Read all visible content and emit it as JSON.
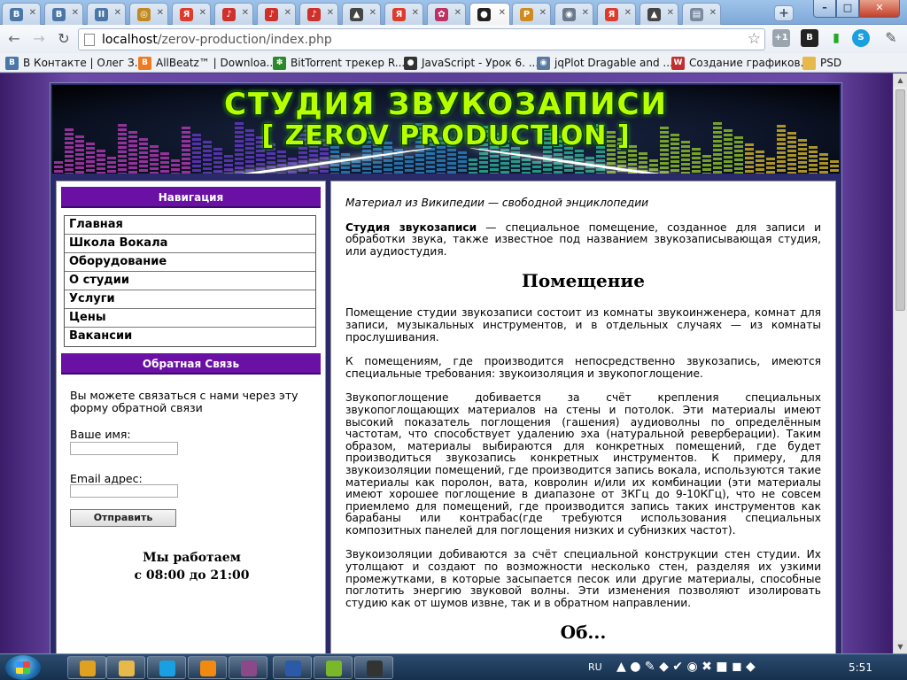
{
  "browser": {
    "tabs": [
      {
        "icon": "vk-icon",
        "glyph": "В",
        "color": "#4a76a8"
      },
      {
        "icon": "vk-icon",
        "glyph": "В",
        "color": "#4a76a8"
      },
      {
        "icon": "pause-icon",
        "glyph": "II",
        "color": "#4a76a8"
      },
      {
        "icon": "ring-icon",
        "glyph": "◎",
        "color": "#c08a20"
      },
      {
        "icon": "yandex-icon",
        "glyph": "Я",
        "color": "#e03a2a"
      },
      {
        "icon": "guitar-icon",
        "glyph": "♪",
        "color": "#d0302a"
      },
      {
        "icon": "guitar-icon",
        "glyph": "♪",
        "color": "#d0302a"
      },
      {
        "icon": "guitar-icon",
        "glyph": "♪",
        "color": "#d0302a"
      },
      {
        "icon": "mortarboard-icon",
        "glyph": "▲",
        "color": "#444444"
      },
      {
        "icon": "yandex-icon",
        "glyph": "Я",
        "color": "#e03a2a"
      },
      {
        "icon": "flower-icon",
        "glyph": "✿",
        "color": "#c03060"
      },
      {
        "icon": "spy-icon",
        "glyph": "●",
        "color": "#222222"
      },
      {
        "icon": "pma-icon",
        "glyph": "P",
        "color": "#d08a20"
      },
      {
        "icon": "globe-icon",
        "glyph": "◉",
        "color": "#6a7a8a"
      },
      {
        "icon": "yandex-icon",
        "glyph": "Я",
        "color": "#e03a2a"
      },
      {
        "icon": "mortarboard-icon",
        "glyph": "▲",
        "color": "#444444"
      },
      {
        "icon": "document-icon",
        "glyph": "▤",
        "color": "#7a8aa0"
      }
    ],
    "url_host": "localhost",
    "url_path": "/zerov-production/index.php",
    "bookmarks": [
      {
        "label": "В Контакте | Олег З...",
        "icon": "vk-icon",
        "glyph": "В",
        "color": "#4a76a8"
      },
      {
        "label": "AllBeatz™ | Downloa...",
        "icon": "blogger-icon",
        "glyph": "B",
        "color": "#f07a20"
      },
      {
        "label": "BitTorrent трекер R...",
        "icon": "rutracker-icon",
        "glyph": "✽",
        "color": "#2a8a2a"
      },
      {
        "label": "JavaScript - Урок 6. ...",
        "icon": "ball-icon",
        "glyph": "●",
        "color": "#333333"
      },
      {
        "label": "jqPlot Dragable and ...",
        "icon": "globe-icon",
        "glyph": "◉",
        "color": "#5a7aa0"
      },
      {
        "label": "Создание графиков...",
        "icon": "w-icon",
        "glyph": "W",
        "color": "#c03030"
      },
      {
        "label": "PSD",
        "icon": "folder-icon",
        "glyph": "",
        "color": "#e6b94a"
      }
    ]
  },
  "site": {
    "banner_line1": "СТУДИЯ ЗВУКОЗАПИСИ",
    "banner_line2": "[ ZEROV PRODUCTION ]",
    "nav_title": "Навигация",
    "nav_items": [
      "Главная",
      "Школа Вокала",
      "Оборудование",
      "О студии",
      "Услуги",
      "Цены",
      "Вакансии"
    ],
    "feedback_title": "Обратная Связь",
    "feedback_text": "Вы можете связаться с нами через эту форму обратной связи",
    "name_label": "Ваше имя:",
    "name_value": "",
    "email_label": "Email адрес:",
    "email_value": "",
    "submit_label": "Отправить",
    "hours_line1": "Мы работаем",
    "hours_line2": "с 08:00 до 21:00"
  },
  "article": {
    "source": "Материал из Википедии — свободной энциклопедии",
    "intro_bold": "Студия звукозаписи",
    "intro_rest": " — специальное помещение, созданное для записи и обработки звука, также известное под названием звукозаписывающая студия, или аудиостудия.",
    "heading1": "Помещение",
    "p1": "Помещение студии звукозаписи состоит из комнаты звукоинженера, комнат для записи, музыкальных инструментов, и в отдельных случаях — из комнаты прослушивания.",
    "p2": "К помещениям, где производится непосредственно звукозапись, имеются специальные требования: звукоизоляция и звукопоглощение.",
    "p3": "Звукопоглощение добивается за счёт крепления специальных звукопоглощающих материалов на стены и потолок. Эти материалы имеют высокий показатель поглощения (гашения) аудиоволны по определённым частотам, что способствует удалению эха (натуральной реверберации). Таким образом, материалы выбираются для конкретных помещений, где будет производиться звукозапись конкретных инструментов. К примеру, для звукоизоляции помещений, где производится запись вокала, используются такие материалы как поролон, вата, ковролин и/или их комбинации (эти материалы имеют хорошее поглощение в диапазоне от 3КГц до 9-10КГц), что не совсем приемлемо для помещений, где производится запись таких инструментов как барабаны или контрабас(где требуются использования специальных композитных панелей для поглощения низких и субнизких частот).",
    "p4": "Звукоизоляции добиваются за счёт специальной конструкции стен студии. Их утолщают и создают по возможности несколько стен, разделяя их узкими промежутками, в которые засыпается песок или другие материалы, способные поглотить энергию звуковой волны. Эти изменения позволяют изолировать студию как от шумов извне, так и в обратном направлении.",
    "heading2": "Об..."
  },
  "taskbar": {
    "apps": [
      {
        "icon": "chrome-icon",
        "color": "#e0a020"
      },
      {
        "icon": "explorer-folder-icon",
        "color": "#e6b94a"
      },
      {
        "icon": "skype-icon",
        "color": "#1aa0e0"
      },
      {
        "icon": "media-player-icon",
        "color": "#f08a10"
      },
      {
        "icon": "winrar-icon",
        "color": "#8a4a8a"
      },
      {
        "icon": "word-icon",
        "color": "#2a5aa8"
      },
      {
        "icon": "android-icon",
        "color": "#7ab82a"
      },
      {
        "icon": "terminal-icon",
        "color": "#333333"
      }
    ],
    "language": "RU",
    "clock": "5:51"
  }
}
